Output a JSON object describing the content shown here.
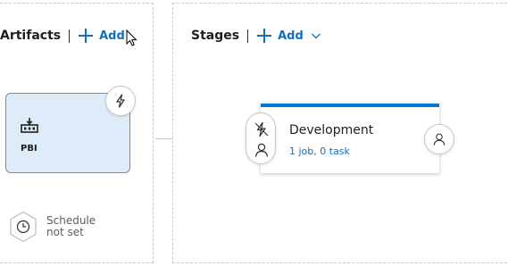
{
  "artifacts": {
    "title": "Artifacts",
    "add_label": "Add",
    "items": [
      {
        "name": "PBI",
        "icon": "build-artifact-icon"
      }
    ],
    "trigger_icon": "lightning-icon",
    "schedule": {
      "line1": "Schedule",
      "line2": "not set",
      "icon": "clock-icon"
    }
  },
  "stages": {
    "title": "Stages",
    "add_label": "Add",
    "items": [
      {
        "name": "Development",
        "summary": "1 job, 0 task",
        "accent_color": "#0078d4"
      }
    ]
  },
  "colors": {
    "link": "#106ebe",
    "artifact_bg": "#deecf9",
    "stage_accent": "#0078d4"
  }
}
